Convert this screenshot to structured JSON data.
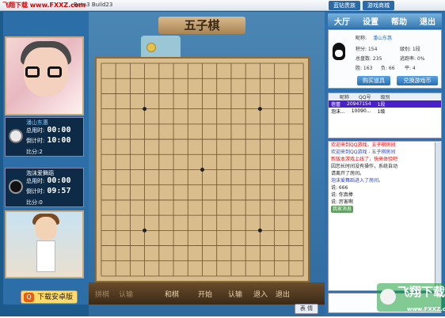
{
  "titlebar": {
    "brand": "飞翔下载 www.FXXZ.com",
    "version": "Beta3 Build23",
    "tabs": [
      "蓝钻贵族",
      "游戏商城"
    ]
  },
  "board_title": "五子棋",
  "player1": {
    "name_tag": "潘山东惠",
    "total_label": "总用时:",
    "total_time": "00:00",
    "count_label": "倒计时:",
    "count_time": "10:00",
    "score_label": "比分:2"
  },
  "player2": {
    "name_tag": "泡沫爱舞蹈",
    "total_label": "总用时:",
    "total_time": "00:00",
    "count_label": "倒计时:",
    "count_time": "09:57",
    "score_label": "比分:0"
  },
  "download_button": "下载安卓版",
  "download_badge": "Q",
  "toolbar": {
    "items": [
      "拼棋",
      "认输",
      "和棋",
      "开始",
      "认输",
      "退入",
      "退出"
    ],
    "chat_button": "表 情"
  },
  "menu": [
    "大厅",
    "设置",
    "帮助",
    "退出"
  ],
  "profile": {
    "nickname_label": "昵称:",
    "nickname": "潘山东惠",
    "score": "积分: 154",
    "level": "级别: 1段",
    "total": "总盘数: 235",
    "escape": "逃跑率: 0%",
    "win": "胜: 163",
    "lose": "负: 66",
    "draw": "平: 4",
    "buy_button": "购买道具",
    "exchange_button": "兑换游戏币"
  },
  "player_list": {
    "headers": [
      "昵称",
      "QQ号",
      "级别"
    ],
    "rows": [
      {
        "name": "蓓蕾",
        "qq": "20947154",
        "level": "1段"
      },
      {
        "name": "泡沫...",
        "qq": "10090...",
        "level": "1级"
      }
    ]
  },
  "chat": {
    "lines": [
      {
        "cls": "red",
        "text": "欢迎来到QQ游戏，五子棋房间"
      },
      {
        "cls": "blue",
        "text": "欢迎来到QQ游戏 - 五子棋房间"
      },
      {
        "cls": "red",
        "text": "新版本游戏上线了，快来体验吧"
      },
      {
        "cls": "black",
        "text": "因您长时间没有操作，系统自动"
      },
      {
        "cls": "black",
        "text": "请离开了房间。"
      },
      {
        "cls": "blue",
        "text": "泡沫爱舞蹈进入了房间。"
      },
      {
        "cls": "black",
        "text": "说: 666"
      },
      {
        "cls": "black",
        "text": "说: 你真棒"
      },
      {
        "cls": "black",
        "text": "说: 厉害啊"
      }
    ],
    "badge": "我家消息"
  },
  "watermark": {
    "title": "飞翔下载",
    "url": "www.FXXZ.com"
  }
}
